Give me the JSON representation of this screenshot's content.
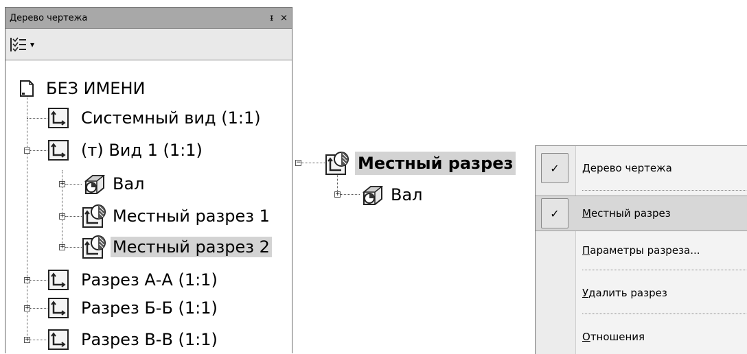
{
  "panel": {
    "title": "Дерево чертежа",
    "pin": "ᵻ",
    "close": "×",
    "toolbar_arrow": "▾"
  },
  "tree": {
    "root": "БЕЗ ИМЕНИ",
    "system_view": "Системный вид (1:1)",
    "view1": "(т) Вид 1 (1:1)",
    "shaft": "Вал",
    "local_cut1": "Местный разрез 1",
    "local_cut2": "Местный разрез 2",
    "section_aa": "Разрез А-А (1:1)",
    "section_bb": "Разрез Б-Б (1:1)",
    "section_vv": "Разрез В-В (1:1)"
  },
  "fragment": {
    "local_cut": "Местный разрез",
    "shaft": "Вал"
  },
  "menu": {
    "items": [
      {
        "label": "Дерево чертежа",
        "checked": true
      },
      {
        "label": "Местный разрез",
        "checked": true
      },
      {
        "label": "Параметры разреза...",
        "checked": false
      },
      {
        "label": "Удалить разрез",
        "checked": false
      },
      {
        "label": "Отношения",
        "checked": false
      }
    ],
    "check_mark": "✓"
  }
}
